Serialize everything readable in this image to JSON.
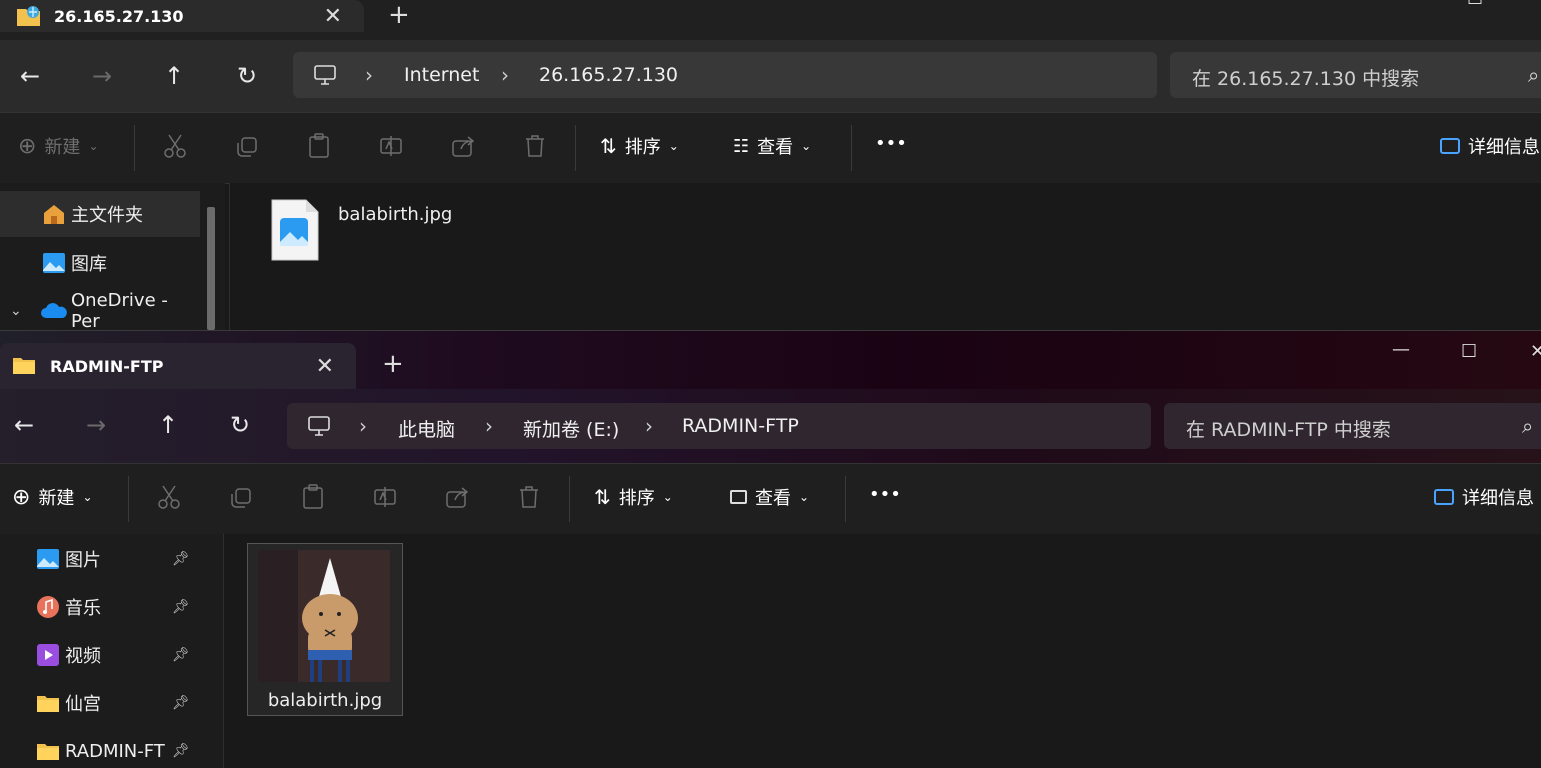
{
  "window1": {
    "tab_title": "26.165.27.130",
    "breadcrumb": [
      "Internet",
      "26.165.27.130"
    ],
    "search_placeholder": "在 26.165.27.130 中搜索",
    "toolbar": {
      "new_label": "新建",
      "sort_label": "排序",
      "view_label": "查看",
      "more_label": "•••",
      "details_label": "详细信息"
    },
    "sidebar": [
      {
        "label": "主文件夹",
        "icon": "home-icon"
      },
      {
        "label": "图库",
        "icon": "gallery-icon"
      },
      {
        "label": "OneDrive - Per",
        "icon": "onedrive-icon"
      }
    ],
    "files": [
      {
        "name": "balabirth.jpg",
        "icon": "image-file-icon"
      }
    ]
  },
  "window2": {
    "tab_title": "RADMIN-FTP",
    "breadcrumb": [
      "此电脑",
      "新加卷 (E:)",
      "RADMIN-FTP"
    ],
    "search_placeholder": "在 RADMIN-FTP 中搜索",
    "toolbar": {
      "new_label": "新建",
      "sort_label": "排序",
      "view_label": "查看",
      "more_label": "•••",
      "details_label": "详细信息"
    },
    "sidebar": [
      {
        "label": "图片",
        "icon": "pictures-icon"
      },
      {
        "label": "音乐",
        "icon": "music-icon"
      },
      {
        "label": "视频",
        "icon": "videos-icon"
      },
      {
        "label": "仙宫",
        "icon": "folder-icon"
      },
      {
        "label": "RADMIN-FT",
        "icon": "folder-icon"
      }
    ],
    "files": [
      {
        "name": "balabirth.jpg",
        "icon": "image-thumbnail"
      }
    ]
  }
}
